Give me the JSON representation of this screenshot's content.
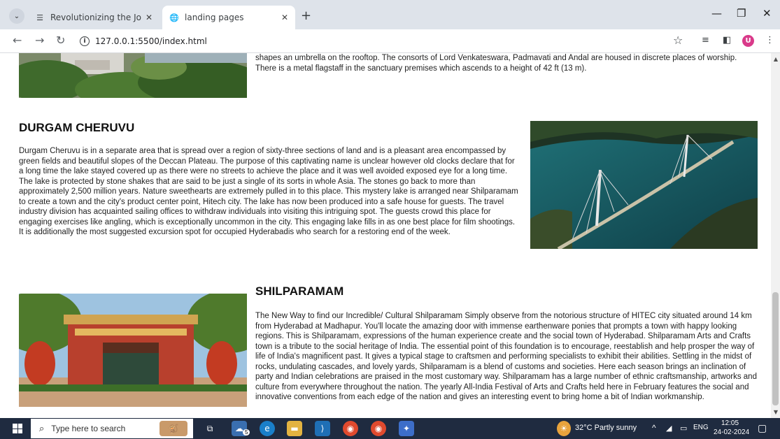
{
  "browser": {
    "tabs": [
      {
        "title": "Revolutionizing the Job Market",
        "active": false
      },
      {
        "title": "landing pages",
        "active": true
      }
    ],
    "url": "127.0.0.1:5500/index.html",
    "profile_initial": "U"
  },
  "page": {
    "top_section": {
      "text": "shapes an umbrella on the rooftop. The consorts of Lord Venkateswara, Padmavati and Andal are housed in discrete places of worship. There is a metal flagstaff in the sanctuary premises which ascends to a height of 42 ft (13 m)."
    },
    "durgam": {
      "title": "DURGAM CHERUVU",
      "text": "Durgam Cheruvu is in a separate area that is spread over a region of sixty-three sections of land and is a pleasant area encompassed by green fields and beautiful slopes of the Deccan Plateau. The purpose of this captivating name is unclear however old clocks declare that for a long time the lake stayed covered up as there were no streets to achieve the place and it was well avoided exposed eye for a long time. The lake is protected by stone shakes that are said to be just a single of its sorts in whole Asia. The stones go back to more than approximately 2,500 million years. Nature sweethearts are extremely pulled in to this place. This mystery lake is arranged near Shilparamam to create a town and the city's product center point, Hitech city. The lake has now been produced into a safe house for guests. The travel industry division has acquainted sailing offices to withdraw individuals into visiting this intriguing spot. The guests crowd this place for engaging exercises like angling, which is exceptionally uncommon in the city. This engaging lake fills in as one best place for film shootings. It is additionally the most suggested excursion spot for occupied Hyderabadis who search for a restoring end of the week."
    },
    "shilparamam": {
      "title": "SHILPARAMAM",
      "text": "The New Way to find our Incredible/ Cultural Shilparamam Simply observe from the notorious structure of HITEC city situated around 14 km from Hyderabad at Madhapur. You'll locate the amazing door with immense earthenware ponies that prompts a town with happy looking regions. This is Shilparamam, expressions of the human experience create and the social town of Hyderabad. Shilparamam Arts and Crafts town is a tribute to the social heritage of India. The essential point of this foundation is to encourage, reestablish and help prosper the way of life of India's magnificent past. It gives a typical stage to craftsmen and performing specialists to exhibit their abilities. Settling in the midst of rocks, undulating cascades, and lovely yards, Shilparamam is a blend of customs and societies. Here each season brings an inclination of party and Indian celebrations are praised in the most customary way. Shilparamam has a large number of ethnic craftsmanship, artworks and culture from everywhere throughout the nation. The yearly All-India Festival of Arts and Crafts held here in February features the social and innovative conventions from each edge of the nation and gives an interesting event to bring home a bit of Indian workmanship."
    }
  },
  "taskbar": {
    "search_placeholder": "Type here to search",
    "weather": "32°C  Partly sunny",
    "language": "ENG",
    "time": "12:05",
    "date": "24-02-2024",
    "badge_count": "5"
  }
}
